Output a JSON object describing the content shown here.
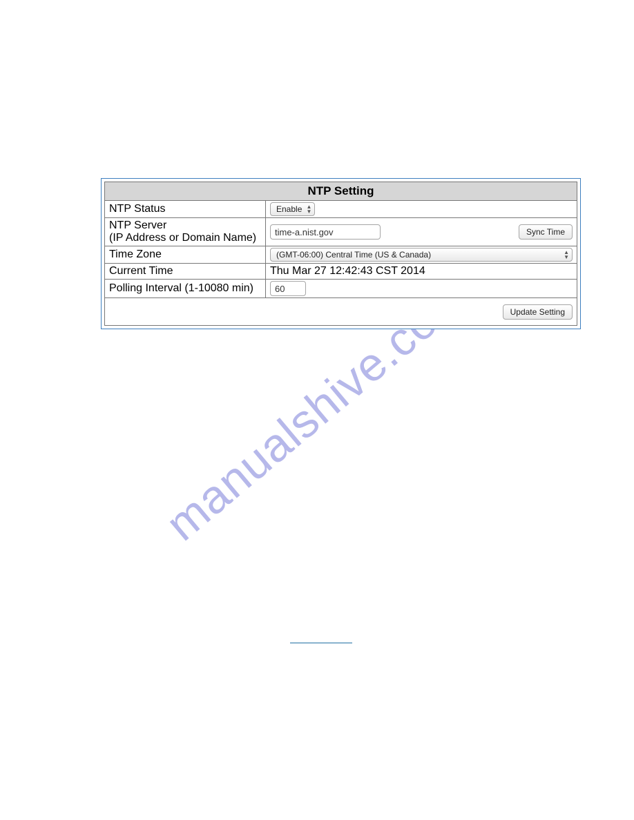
{
  "watermark": "manualshive.com",
  "panel": {
    "title": "NTP Setting",
    "rows": {
      "status": {
        "label": "NTP Status",
        "value": "Enable"
      },
      "server": {
        "label_line1": "NTP Server",
        "label_line2": "(IP Address or Domain Name)",
        "value": "time-a.nist.gov",
        "button": "Sync Time"
      },
      "timezone": {
        "label": "Time Zone",
        "value": "(GMT-06:00) Central Time (US & Canada)"
      },
      "current_time": {
        "label": "Current Time",
        "value": "Thu Mar 27 12:42:43 CST 2014"
      },
      "polling": {
        "label": "Polling Interval (1-10080 min)",
        "value": "60"
      }
    },
    "footer": {
      "update_button": "Update Setting"
    }
  }
}
